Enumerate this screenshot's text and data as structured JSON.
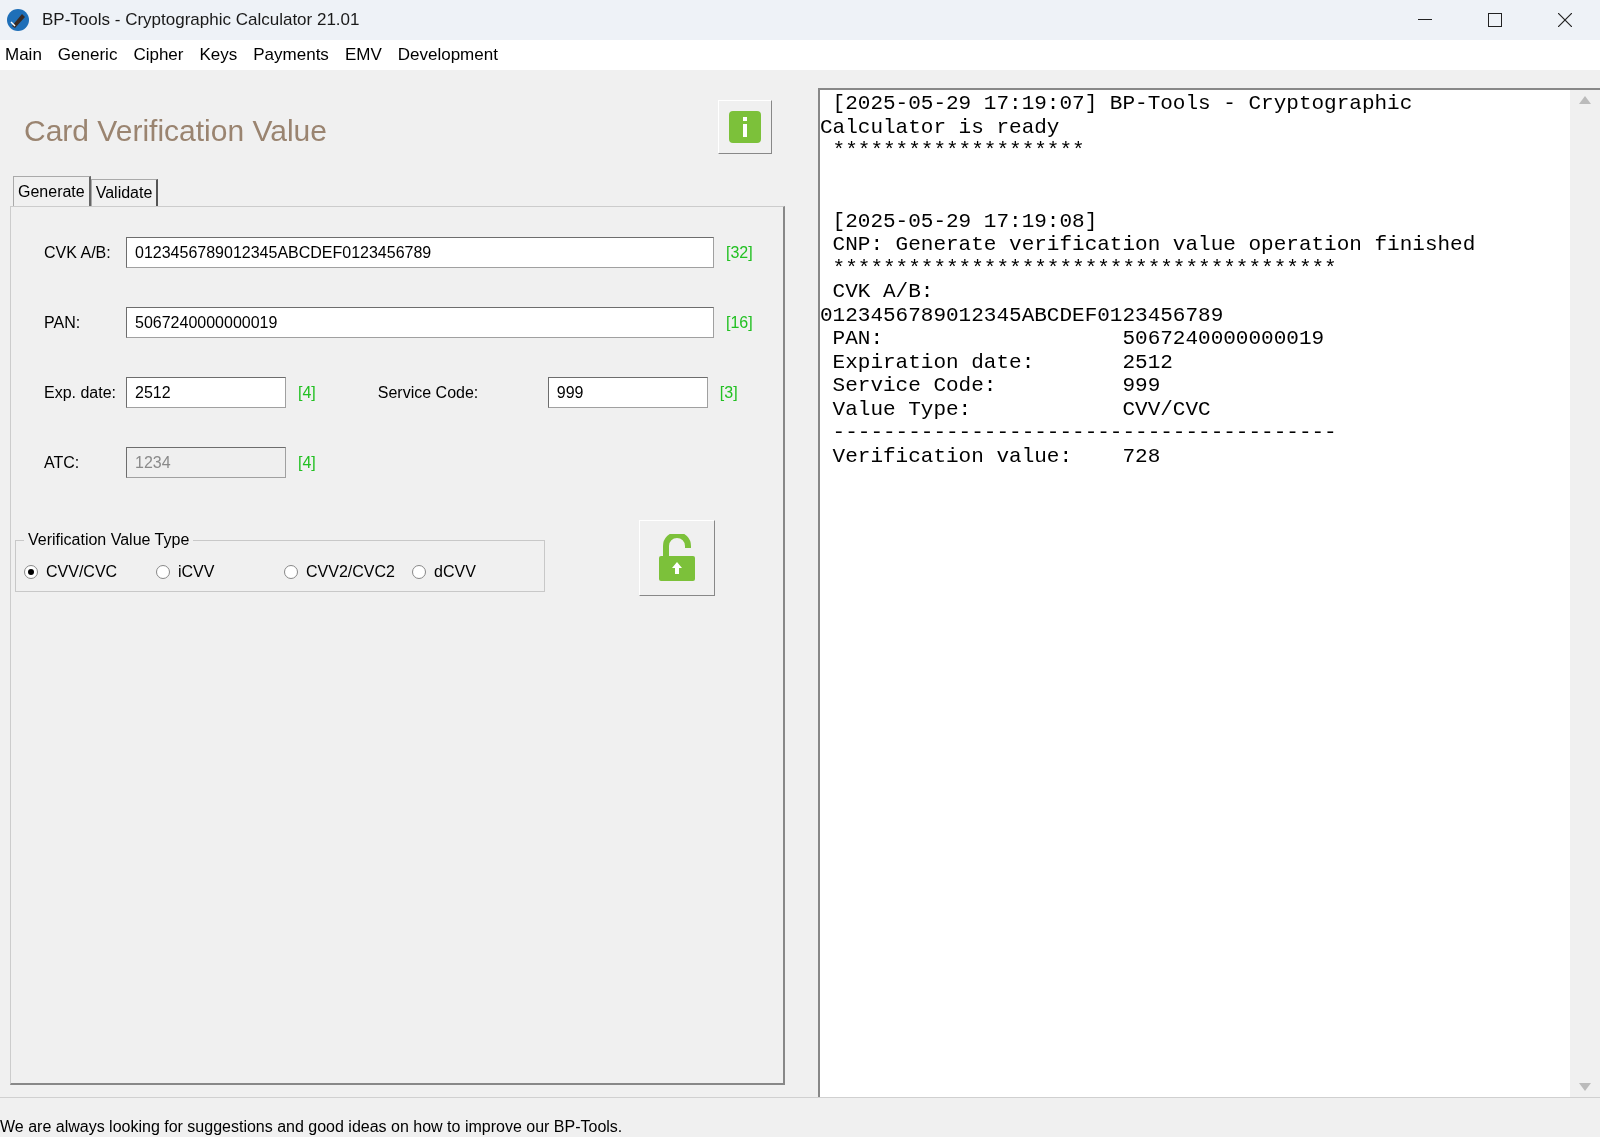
{
  "window": {
    "title": "BP-Tools - Cryptographic Calculator 21.01"
  },
  "menu": [
    "Main",
    "Generic",
    "Cipher",
    "Keys",
    "Payments",
    "EMV",
    "Development"
  ],
  "panel": {
    "title": "Card Verification Value",
    "tabs": [
      {
        "label": "Generate",
        "selected": true
      },
      {
        "label": "Validate",
        "selected": false
      }
    ],
    "fields": [
      {
        "label": "CVK A/B:",
        "value": "0123456789012345ABCDEF0123456789",
        "count": "[32]",
        "disabled": false
      },
      {
        "label": "PAN:",
        "value": "5067240000000019",
        "count": "[16]",
        "disabled": false
      },
      {
        "label": "Exp. date:",
        "value": "2512",
        "count": "[4]",
        "disabled": false
      },
      {
        "label": "Service Code:",
        "value": "999",
        "count": "[3]",
        "disabled": false
      },
      {
        "label": "ATC:",
        "value": "1234",
        "count": "[4]",
        "disabled": true
      }
    ],
    "value_type": {
      "legend": "Verification Value Type",
      "options": [
        {
          "label": "CVV/CVC",
          "selected": true
        },
        {
          "label": "iCVV",
          "selected": false
        },
        {
          "label": "CVV2/CVC2",
          "selected": false
        },
        {
          "label": "dCVV",
          "selected": false
        }
      ]
    }
  },
  "log": {
    "entries": [
      {
        "lines": [
          " [2025-05-29 17:19:07] BP-Tools - Cryptographic",
          "Calculator is ready",
          " ********************"
        ]
      },
      {
        "lines": [
          " [2025-05-29 17:19:08]",
          " CNP: Generate verification value operation finished",
          " ****************************************",
          " CVK A/B:",
          "0123456789012345ABCDEF0123456789",
          " PAN:                   5067240000000019",
          " Expiration date:       2512",
          " Service Code:          999",
          " Value Type:            CVV/CVC",
          " ----------------------------------------",
          " Verification value:    728"
        ]
      }
    ]
  },
  "status_bar": "We are always looking for suggestions and good ideas on how to improve our BP-Tools."
}
